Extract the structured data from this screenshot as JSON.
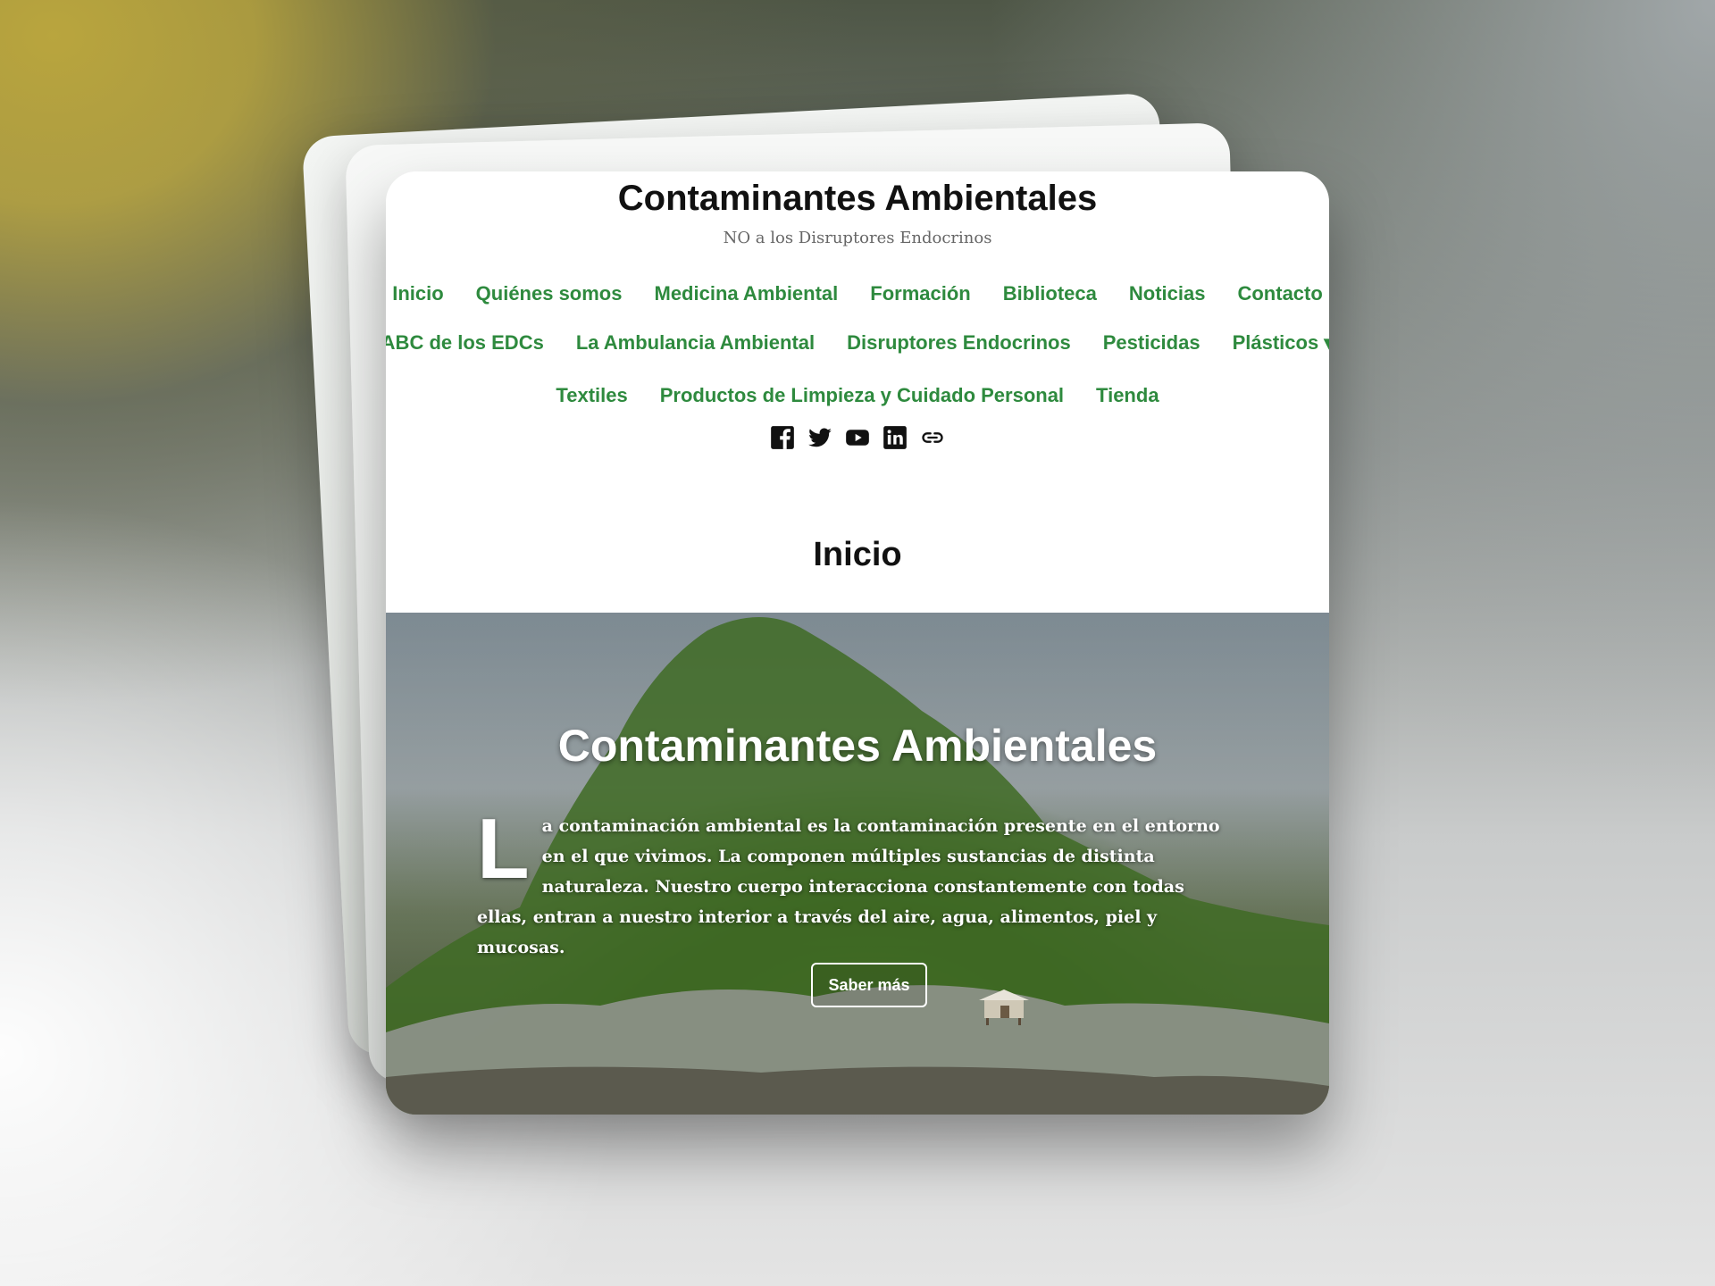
{
  "site": {
    "title": "Contaminantes Ambientales",
    "tagline": "NO a los Disruptores Endocrinos"
  },
  "nav": {
    "row1": [
      "Inicio",
      "Quiénes somos",
      "Medicina Ambiental",
      "Formación",
      "Biblioteca",
      "Noticias",
      "Contacto"
    ],
    "row2": [
      "ABC de los EDCs",
      "La Ambulancia Ambiental",
      "Disruptores Endocrinos",
      "Pesticidas",
      "Plásticos ▾"
    ],
    "row3": [
      "Textiles",
      "Productos de Limpieza y Cuidado Personal",
      "Tienda"
    ]
  },
  "social": [
    "facebook-icon",
    "twitter-icon",
    "youtube-icon",
    "linkedin-icon",
    "link-icon"
  ],
  "page": {
    "title": "Inicio"
  },
  "hero": {
    "title": "Contaminantes Ambientales",
    "dropcap": "L",
    "body": "a contaminación ambiental es la contaminación presente en el entorno en el que vivimos. La componen múltiples sustancias de distinta naturaleza. Nuestro cuerpo interacciona constantemente con todas ellas, entran a nuestro interior a través del aire, agua, alimentos, piel y mucosas.",
    "button": "Saber más"
  },
  "colors": {
    "nav_link": "#2e8a3e",
    "title": "#111111"
  }
}
